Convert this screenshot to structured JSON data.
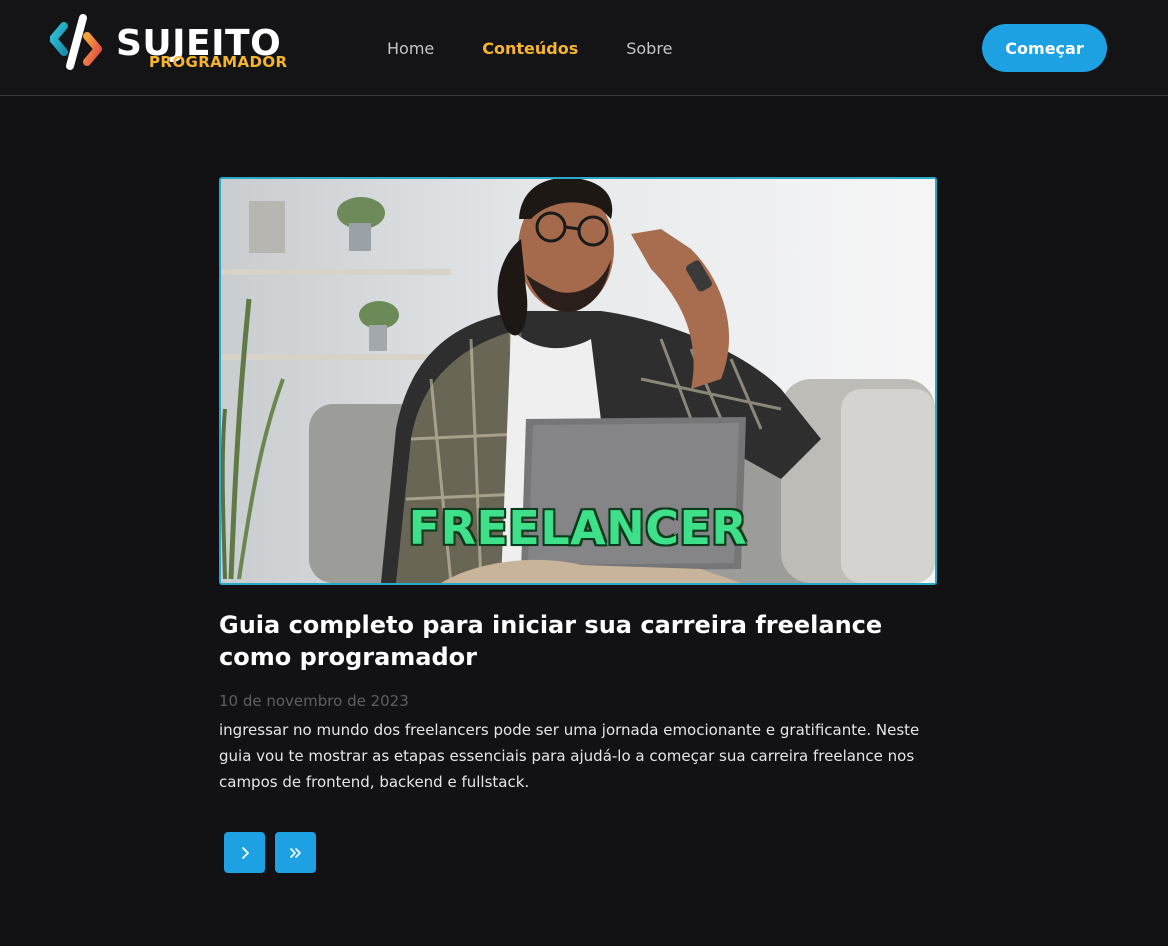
{
  "header": {
    "logo": {
      "title": "SUJEITO",
      "subtitle": "PROGRAMADOR"
    },
    "nav": [
      {
        "label": "Home",
        "active": false
      },
      {
        "label": "Conteúdos",
        "active": true
      },
      {
        "label": "Sobre",
        "active": false
      }
    ],
    "cta_label": "Começar"
  },
  "post": {
    "image_text": "FREELANCER",
    "title": "Guia completo para iniciar sua carreira freelance como programador",
    "date": "10 de novembro de 2023",
    "excerpt": "ingressar no mundo dos freelancers pode ser uma jornada emocionante e gratificante. Neste guia vou te mostrar as etapas essenciais para ajudá-lo a começar sua carreira freelance nos campos de frontend, backend e fullstack."
  },
  "pagination": {
    "next_icon": "chevron-right-icon",
    "last_icon": "double-chevron-right-icon"
  },
  "colors": {
    "background": "#121214",
    "accent": "#1da1e2",
    "brand_yellow": "#f7b52e",
    "banner_text": "#3fe08a"
  }
}
